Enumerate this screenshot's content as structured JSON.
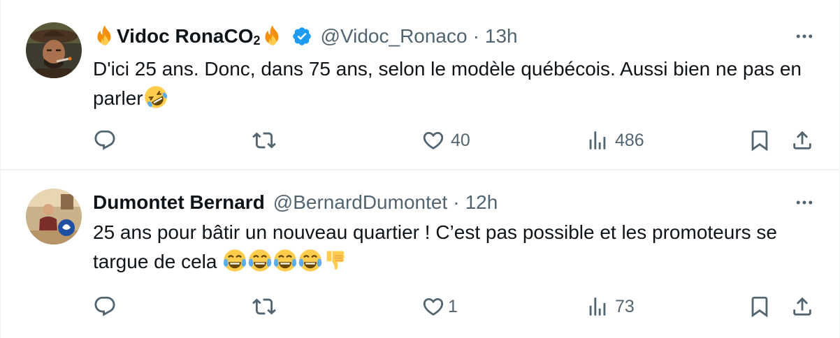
{
  "tweets": [
    {
      "display_name": "Vidoc RonaCO",
      "name_subscript": "2",
      "name_emoji": "fire-emoji",
      "verified": true,
      "handle": "@Vidoc_Ronaco",
      "separator": "·",
      "time": "13h",
      "text": "D'ici 25 ans. Donc, dans 75 ans, selon le modèle québécois. Aussi bien ne pas en parler",
      "text_emojis": [
        "rolling-on-floor-laughing-emoji"
      ],
      "reply_count": "",
      "retweet_count": "",
      "like_count": "40",
      "view_count": "486"
    },
    {
      "display_name": "Dumontet Bernard",
      "verified": false,
      "handle": "@BernardDumontet",
      "separator": "·",
      "time": "12h",
      "text": "25 ans pour bâtir un nouveau quartier ! C’est pas possible et les promoteurs se targue de cela",
      "text_emojis": [
        "tears-of-joy-emoji",
        "tears-of-joy-emoji",
        "tears-of-joy-emoji",
        "tears-of-joy-emoji",
        "thumbs-down-emoji"
      ],
      "reply_count": "",
      "retweet_count": "",
      "like_count": "1",
      "view_count": "73"
    }
  ],
  "colors": {
    "text": "#0f1419",
    "secondary": "#536471",
    "verified": "#1d9bf0",
    "divider": "#eff3f4"
  },
  "icons": [
    "reply-icon",
    "retweet-icon",
    "like-icon",
    "views-icon",
    "bookmark-icon",
    "share-icon",
    "more-icon",
    "verified-badge-icon"
  ]
}
